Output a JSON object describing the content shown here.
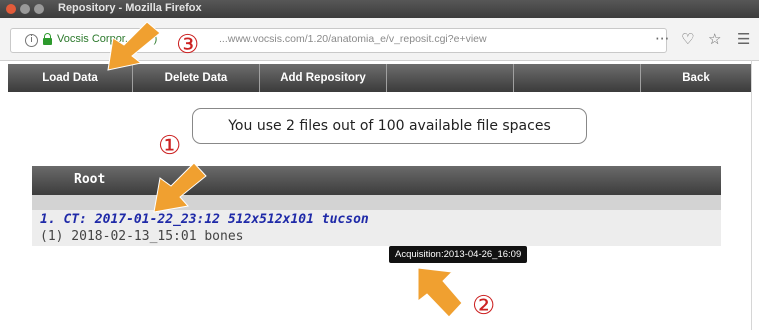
{
  "window": {
    "title": "Repository - Mozilla Firefox"
  },
  "navbar": {
    "info_glyph": "i",
    "site_identity": "Vocsis Corpor... (JP)",
    "url": "...www.vocsis.com/1.20/anatomia_e/v_reposit.cgi?e+view",
    "more_glyph": "···",
    "pocket_glyph": "♡",
    "bookmark_glyph": "☆",
    "menu_glyph": "☰"
  },
  "toolbar": {
    "buttons": [
      "Load Data",
      "Delete Data",
      "Add Repository",
      "",
      "",
      "Back"
    ]
  },
  "usage": {
    "text": "You use 2 files out of 100 available file spaces"
  },
  "repository": {
    "root_label": "Root",
    "entries": [
      {
        "title": "1. CT: 2017-01-22_23:12 512x512x101 tucson",
        "sub": "(1) 2018-02-13_15:01 bones"
      }
    ]
  },
  "tooltip": {
    "text": "Acquisition:2013-04-26_16:09"
  },
  "annotations": {
    "markers": [
      "①",
      "②",
      "③"
    ],
    "color": "#f0a030",
    "marker_color": "#cc2222"
  }
}
